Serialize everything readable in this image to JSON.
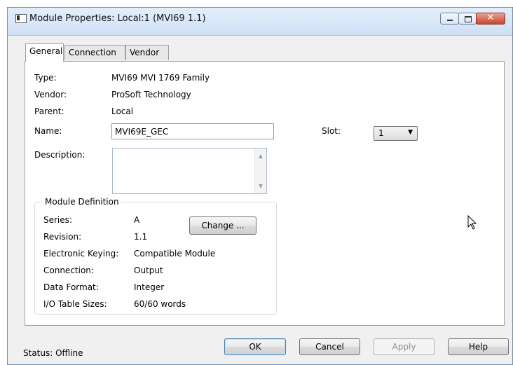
{
  "window": {
    "title": "Module Properties: Local:1 (MVI69 1.1)"
  },
  "tabs": [
    {
      "label": "General",
      "active": true
    },
    {
      "label": "Connection",
      "active": false
    },
    {
      "label": "Vendor",
      "active": false
    }
  ],
  "general": {
    "type_label": "Type:",
    "type_value": "MVI69 MVI 1769 Family",
    "vendor_label": "Vendor:",
    "vendor_value": "ProSoft Technology",
    "parent_label": "Parent:",
    "parent_value": "Local",
    "name_label": "Name:",
    "name_value": "MVI69E_GEC",
    "description_label": "Description:",
    "description_value": "",
    "slot_label": "Slot:",
    "slot_value": "1"
  },
  "module_definition": {
    "legend": "Module Definition",
    "change_button": "Change ...",
    "rows": [
      {
        "label": "Series:",
        "value": "A"
      },
      {
        "label": "Revision:",
        "value": "1.1"
      },
      {
        "label": "Electronic Keying:",
        "value": "Compatible Module"
      },
      {
        "label": "Connection:",
        "value": "Output"
      },
      {
        "label": "Data Format:",
        "value": "Integer"
      },
      {
        "label": "I/O Table Sizes:",
        "value": "60/60 words"
      }
    ]
  },
  "footer": {
    "status_label": "Status:",
    "status_value": "Offline",
    "ok": "OK",
    "cancel": "Cancel",
    "apply": "Apply",
    "help": "Help"
  },
  "colors": {
    "title_gradient": "#cfe0f5",
    "close_button": "#c9462c",
    "input_border": "#7a9cc6"
  },
  "icons": [
    "app-icon",
    "minimize-icon",
    "maximize-icon",
    "close-icon",
    "scroll-up-icon",
    "scroll-down-icon",
    "dropdown-arrow-icon",
    "mouse-cursor-icon"
  ]
}
